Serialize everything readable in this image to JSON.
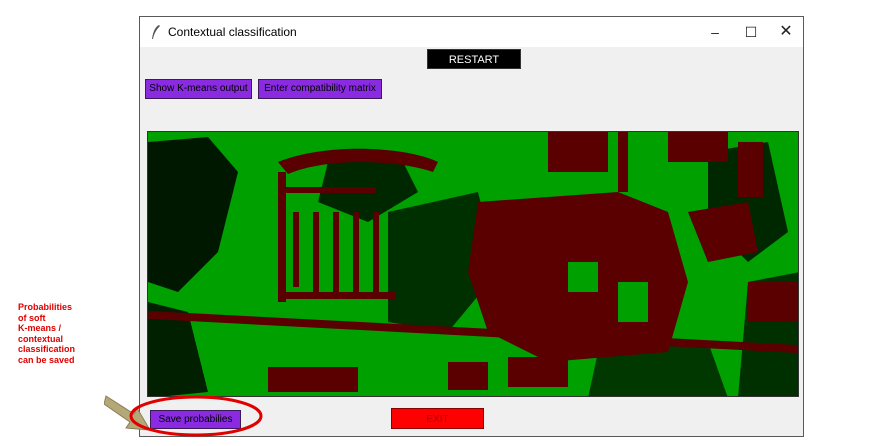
{
  "window": {
    "title": "Contextual classification",
    "controls": {
      "minimize": "–",
      "maximize": "☐",
      "close": "✕"
    }
  },
  "toolbar": {
    "restart_label": "RESTART",
    "kmeans_label": "Show K-means output",
    "compat_label": "Enter compatibility matrix"
  },
  "bottom": {
    "save_label": "Save probabilies",
    "exit_label": "EXIT"
  },
  "annotation": {
    "lines": [
      "Probabilities",
      "of soft",
      "K-means /",
      "contextual",
      "classification",
      "can be saved"
    ],
    "color": "#e00000",
    "arrow_color": "#b4a878"
  },
  "map": {
    "classes": [
      {
        "color": "#00a000"
      },
      {
        "color": "#5a0000"
      },
      {
        "color": "#000000"
      }
    ]
  },
  "colors": {
    "purple_button": "#8a2be2",
    "exit_button": "#ff0000",
    "restart_button": "#000000"
  }
}
